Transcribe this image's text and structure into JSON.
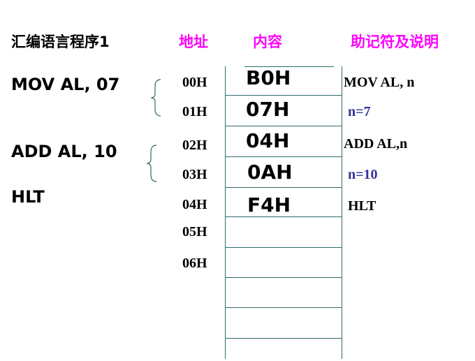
{
  "header": {
    "program_title": "汇编语言程序1",
    "col_address": "地址",
    "col_content": "内容",
    "col_mnemonic": "助记符及说明"
  },
  "program": {
    "lines": [
      "MOV AL, 07",
      "ADD AL, 10",
      "HLT"
    ]
  },
  "memory": {
    "rows": [
      {
        "address": "00H",
        "content": "B0H",
        "note": "MOV AL, n"
      },
      {
        "address": "01H",
        "content": "07H",
        "note": "n=7"
      },
      {
        "address": "02H",
        "content": "04H",
        "note": "ADD AL,n"
      },
      {
        "address": "03H",
        "content": "0AH",
        "note": "n=10"
      },
      {
        "address": "04H",
        "content": "F4H",
        "note": "HLT"
      },
      {
        "address": "05H",
        "content": "",
        "note": ""
      },
      {
        "address": "06H",
        "content": "",
        "note": ""
      }
    ]
  },
  "colors": {
    "header_magenta": "#ff00ff",
    "param_blue": "#333399",
    "grid_teal": "#2e6b6b"
  }
}
